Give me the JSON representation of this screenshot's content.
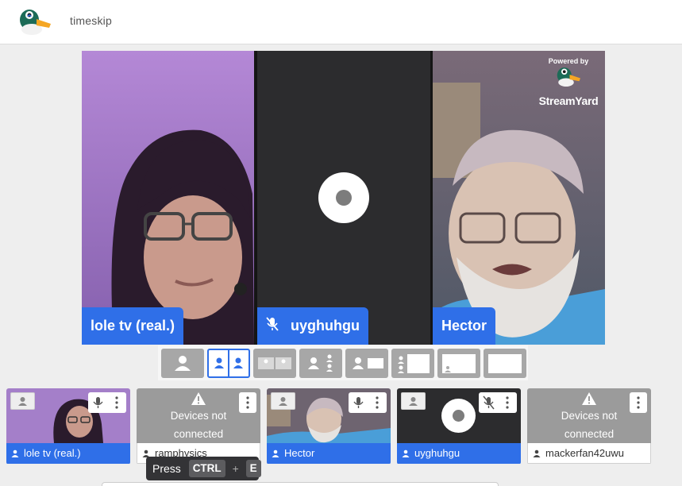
{
  "app": {
    "title": "timeskip"
  },
  "watermark": {
    "powered": "Powered by",
    "brand": "StreamYard"
  },
  "stage": {
    "participants": [
      {
        "name": "lole tv (real.)",
        "video": true,
        "muted": false
      },
      {
        "name": "uyghuhgu",
        "video": false,
        "muted": true
      },
      {
        "name": "Hector",
        "video": true,
        "muted": false
      }
    ]
  },
  "layouts": [
    {
      "name": "solo",
      "selected": false
    },
    {
      "name": "cropped-grid",
      "selected": true
    },
    {
      "name": "grid",
      "selected": false
    },
    {
      "name": "group",
      "selected": false
    },
    {
      "name": "leader",
      "selected": false
    },
    {
      "name": "sidebar",
      "selected": false
    },
    {
      "name": "picture-in-picture",
      "selected": false
    },
    {
      "name": "full-screen",
      "selected": false
    }
  ],
  "backstage": [
    {
      "name": "lole tv (real.)",
      "status": "video"
    },
    {
      "name": "ramphysics",
      "status": "no-devices",
      "status_line1": "Devices not",
      "status_line2": "connected"
    },
    {
      "name": "Hector",
      "status": "video"
    },
    {
      "name": "uyghuhgu",
      "status": "no-video"
    },
    {
      "name": "mackerfan42uwu",
      "status": "no-devices",
      "status_line1": "Devices not",
      "status_line2": "connected"
    }
  ],
  "tooltip": {
    "press": "Press",
    "key1": "CTRL",
    "plus": "+",
    "key2": "E"
  },
  "colors": {
    "accent": "#2f6fe8",
    "stage_bg": "#2b2b2b",
    "tile_gray": "#9b9b9b",
    "header_bg": "#ffffff"
  }
}
